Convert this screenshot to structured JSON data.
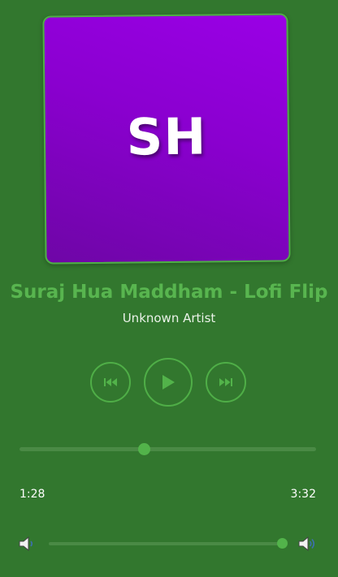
{
  "track": {
    "art_initials": "SH",
    "title": "Suraj Hua Maddham - Lofi Flip",
    "artist": "Unknown Artist"
  },
  "controls": {
    "prev_icon": "skip-previous-icon",
    "play_icon": "play-icon",
    "next_icon": "skip-next-icon"
  },
  "progress": {
    "current": "1:28",
    "total": "3:32",
    "fraction": 0.42
  },
  "volume": {
    "low_icon": "speaker-low-icon",
    "high_icon": "speaker-high-icon",
    "fraction": 0.99
  },
  "colors": {
    "background": "#32772e",
    "accent": "#52b34a",
    "track": "#4a8a45",
    "art_gradient_start": "#9a00e6",
    "art_gradient_end": "#6e06a6"
  }
}
